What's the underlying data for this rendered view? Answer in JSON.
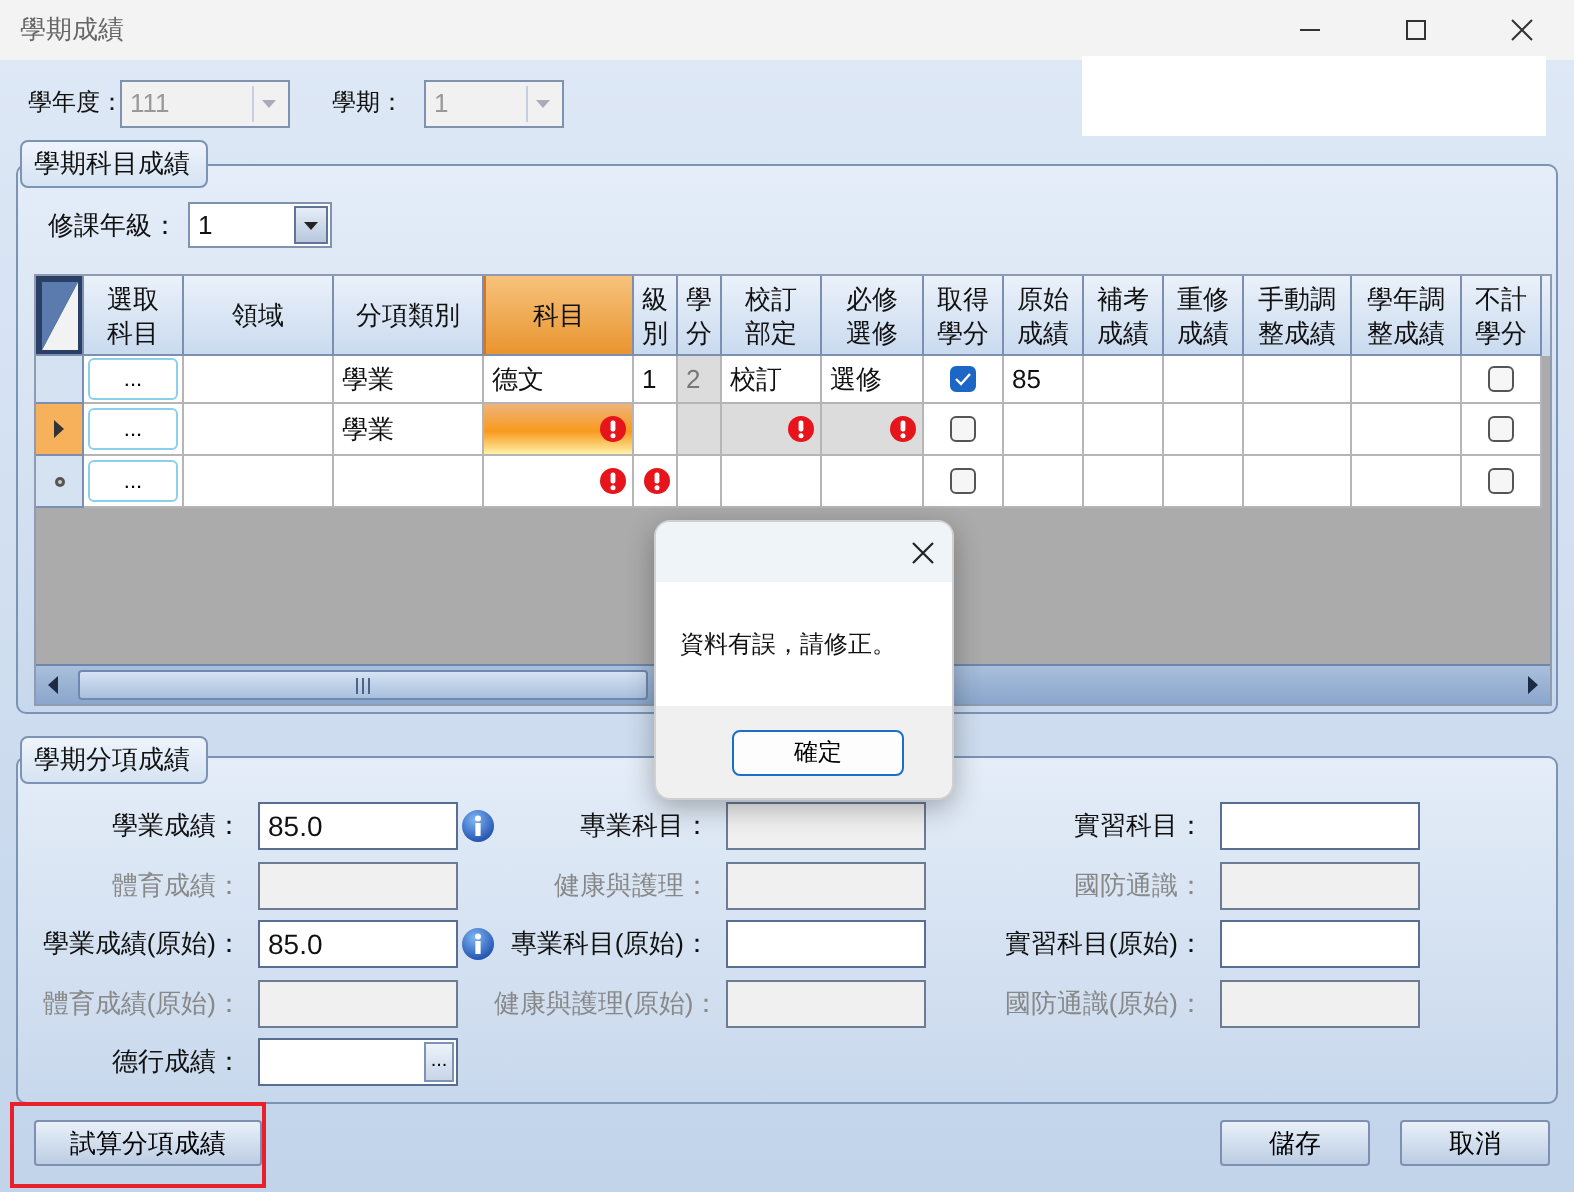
{
  "window": {
    "title": "學期成績"
  },
  "filters": [
    {
      "label": "學年度：",
      "value": "111",
      "disabled": true
    },
    {
      "label": "學期：",
      "value": "1",
      "disabled": true
    }
  ],
  "subject_group": {
    "title": "學期科目成績",
    "grade_label": "修課年級：",
    "grade_value": "1",
    "columns": [
      {
        "text": "選取科目",
        "selected": false
      },
      {
        "text": "領域",
        "selected": false
      },
      {
        "text": "分項類別",
        "selected": false
      },
      {
        "text": "科目",
        "selected": true
      },
      {
        "text": "級別",
        "selected": false
      },
      {
        "text": "學分",
        "selected": false
      },
      {
        "text": "校訂部定",
        "selected": false
      },
      {
        "text": "必修選修",
        "selected": false
      },
      {
        "text": "取得學分",
        "selected": false
      },
      {
        "text": "原始成績",
        "selected": false
      },
      {
        "text": "補考成績",
        "selected": false
      },
      {
        "text": "重修成績",
        "selected": false
      },
      {
        "text": "手動調整成績",
        "selected": false
      },
      {
        "text": "學年調整成績",
        "selected": false
      },
      {
        "text": "不計學分",
        "selected": false
      }
    ],
    "rows": [
      {
        "current": false,
        "new_row": false,
        "cells": [
          {
            "kind": "button",
            "text": "..."
          },
          {
            "kind": "text",
            "error": false,
            "selected": false
          },
          {
            "kind": "text",
            "text": "學業",
            "error": false,
            "selected": false
          },
          {
            "kind": "text",
            "text": "德文",
            "error": false,
            "selected": false
          },
          {
            "kind": "text",
            "text": "1",
            "error": false,
            "selected": false
          },
          {
            "kind": "locked",
            "text": "2",
            "error": false,
            "selected": false
          },
          {
            "kind": "text",
            "text": "校訂",
            "error": false,
            "selected": false
          },
          {
            "kind": "text",
            "text": "選修",
            "error": false,
            "selected": false
          },
          {
            "kind": "check",
            "checked": true
          },
          {
            "kind": "text",
            "text": "85",
            "error": false,
            "selected": false
          },
          {
            "kind": "text",
            "error": false,
            "selected": false
          },
          {
            "kind": "text",
            "error": false,
            "selected": false
          },
          {
            "kind": "text",
            "error": false,
            "selected": false
          },
          {
            "kind": "text",
            "error": false,
            "selected": false
          },
          {
            "kind": "check",
            "checked": false
          }
        ]
      },
      {
        "current": true,
        "new_row": false,
        "cells": [
          {
            "kind": "button",
            "text": "..."
          },
          {
            "kind": "text",
            "error": false,
            "selected": false
          },
          {
            "kind": "text",
            "text": "學業",
            "error": false,
            "selected": false
          },
          {
            "kind": "text",
            "error": true,
            "selected": true
          },
          {
            "kind": "text",
            "error": false,
            "selected": false
          },
          {
            "kind": "locked",
            "error": false,
            "selected": false
          },
          {
            "kind": "locked",
            "error": true,
            "selected": false
          },
          {
            "kind": "locked",
            "error": true,
            "selected": false
          },
          {
            "kind": "check",
            "checked": false
          },
          {
            "kind": "text",
            "error": false,
            "selected": false
          },
          {
            "kind": "text",
            "error": false,
            "selected": false
          },
          {
            "kind": "text",
            "error": false,
            "selected": false
          },
          {
            "kind": "text",
            "error": false,
            "selected": false
          },
          {
            "kind": "text",
            "error": false,
            "selected": false
          },
          {
            "kind": "check",
            "checked": false
          }
        ]
      },
      {
        "current": false,
        "new_row": true,
        "cells": [
          {
            "kind": "button",
            "text": "..."
          },
          {
            "kind": "text",
            "error": false,
            "selected": false
          },
          {
            "kind": "text",
            "error": false,
            "selected": false
          },
          {
            "kind": "text",
            "error": true,
            "selected": false
          },
          {
            "kind": "text",
            "error": true,
            "selected": false
          },
          {
            "kind": "text",
            "error": false,
            "selected": false
          },
          {
            "kind": "text",
            "error": false,
            "selected": false
          },
          {
            "kind": "text",
            "error": false,
            "selected": false
          },
          {
            "kind": "check",
            "checked": false
          },
          {
            "kind": "text",
            "error": false,
            "selected": false
          },
          {
            "kind": "text",
            "error": false,
            "selected": false
          },
          {
            "kind": "text",
            "error": false,
            "selected": false
          },
          {
            "kind": "text",
            "error": false,
            "selected": false
          },
          {
            "kind": "text",
            "error": false,
            "selected": false
          },
          {
            "kind": "check",
            "checked": false
          }
        ]
      }
    ]
  },
  "summary_group": {
    "title": "學期分項成績",
    "rows": [
      [
        {
          "label": "學業成績：",
          "kind": "info",
          "value": "85.0",
          "disabled": false,
          "label_dimmed": false
        },
        {
          "label": "專業科目：",
          "kind": "text",
          "disabled": true,
          "label_dimmed": false
        },
        {
          "label": "實習科目：",
          "kind": "text",
          "disabled": false,
          "label_dimmed": false
        }
      ],
      [
        {
          "label": "體育成績：",
          "kind": "text",
          "disabled": true,
          "label_dimmed": true
        },
        {
          "label": "健康與護理：",
          "kind": "text",
          "disabled": true,
          "label_dimmed": true
        },
        {
          "label": "國防通識：",
          "kind": "text",
          "disabled": true,
          "label_dimmed": true
        }
      ],
      [
        {
          "label": "學業成績(原始)：",
          "kind": "info",
          "value": "85.0",
          "disabled": false,
          "label_dimmed": false
        },
        {
          "label": "專業科目(原始)：",
          "kind": "text",
          "disabled": false,
          "label_dimmed": false
        },
        {
          "label": "實習科目(原始)：",
          "kind": "text",
          "disabled": false,
          "label_dimmed": false
        }
      ],
      [
        {
          "label": "體育成績(原始)：",
          "kind": "text",
          "disabled": true,
          "label_dimmed": true
        },
        {
          "label": "健康與護理(原始)：",
          "kind": "text",
          "disabled": true,
          "label_dimmed": true
        },
        {
          "label": "國防通識(原始)：",
          "kind": "text",
          "disabled": true,
          "label_dimmed": true
        }
      ],
      [
        {
          "label": "德行成績：",
          "kind": "picker",
          "button": "...",
          "disabled": false,
          "label_dimmed": false
        }
      ]
    ]
  },
  "calc_button": {
    "label": "試算分項成績",
    "highlighted": true
  },
  "buttons": [
    "儲存",
    "取消"
  ],
  "dialog": {
    "message": "資料有誤，請修正。",
    "button": "確定"
  }
}
